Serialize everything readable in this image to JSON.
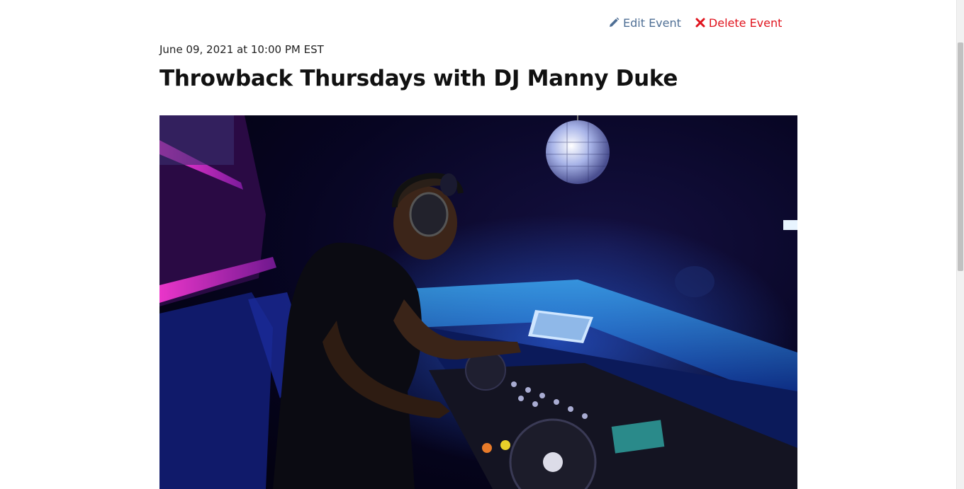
{
  "actions": {
    "edit_label": "Edit Event",
    "delete_label": "Delete Event"
  },
  "event": {
    "datetime": "June 09, 2021 at 10:00 PM EST",
    "title": "Throwback Thursdays with DJ Manny Duke",
    "image_icon": "dj-photo"
  },
  "colors": {
    "edit": "#4f6f95",
    "delete": "#e0141e",
    "title": "#111111"
  }
}
